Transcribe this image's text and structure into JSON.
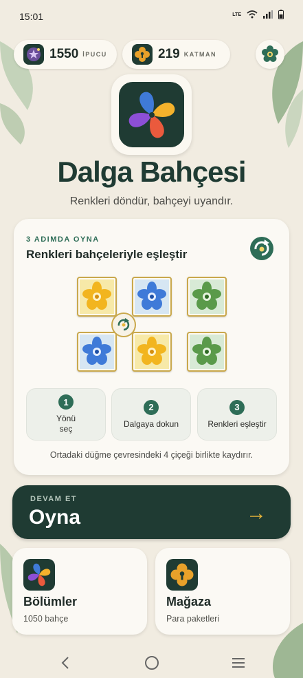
{
  "status_bar": {
    "time": "15:01",
    "network": "LTE"
  },
  "resources": {
    "hints": {
      "count": "1550",
      "label": "İPUCU",
      "icon": "star-hint-icon"
    },
    "layers": {
      "count": "219",
      "label": "KATMAN",
      "icon": "keyhole-flower-icon"
    }
  },
  "settings": {
    "icon": "flower-gear-icon"
  },
  "app": {
    "title": "Dalga Bahçesi",
    "subtitle": "Renkleri döndür, bahçeyi uyandır."
  },
  "tutorial": {
    "kicker": "3 ADIMDA OYNA",
    "title": "Renkleri bahçeleriyle eşleştir",
    "grid": [
      [
        "gold",
        "blue",
        "green"
      ],
      [
        "blue",
        "gold",
        "green"
      ]
    ],
    "steps": [
      {
        "num": "1",
        "label_line1": "Yönü",
        "label_line2": "seç"
      },
      {
        "num": "2",
        "label": "Dalgaya dokun"
      },
      {
        "num": "3",
        "label": "Renkleri eşleştir"
      }
    ],
    "note": "Ortadaki düğme çevresindeki 4 çiçeği birlikte kaydırır."
  },
  "play": {
    "kicker": "DEVAM ET",
    "label": "Oyna",
    "arrow": "→"
  },
  "cards": {
    "chapters": {
      "title": "Bölümler",
      "subtitle": "1050 bahçe"
    },
    "shop": {
      "title": "Mağaza",
      "subtitle": "Para paketleri"
    }
  },
  "colors": {
    "brand_dark": "#1f3b33",
    "accent_green": "#2e6d57",
    "gold": "#e8b63a",
    "background": "#f1ece1"
  }
}
